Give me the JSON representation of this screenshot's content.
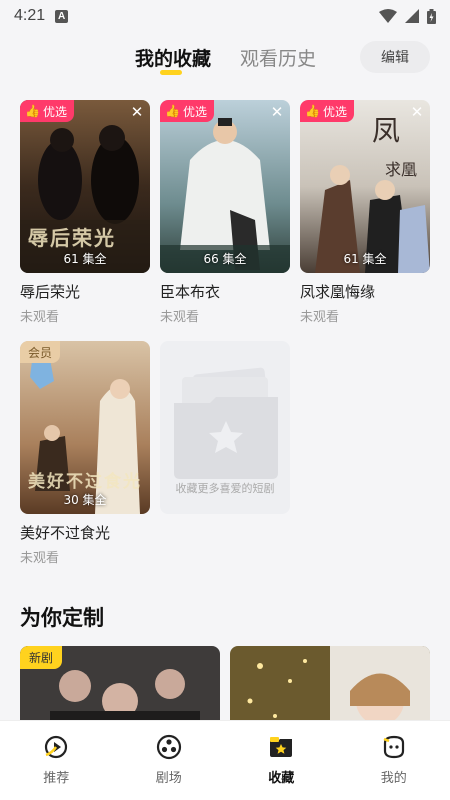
{
  "status": {
    "time": "4:21",
    "a_label": "A"
  },
  "tabs": {
    "favorites": "我的收藏",
    "history": "观看历史",
    "edit": "编辑"
  },
  "favorites": [
    {
      "badge": "优选",
      "title": "辱后荣光",
      "episodes": "61 集全",
      "status": "未观看",
      "overlay": "辱后荣光"
    },
    {
      "badge": "优选",
      "title": "臣本布衣",
      "episodes": "66 集全",
      "status": "未观看",
      "overlay": ""
    },
    {
      "badge": "优选",
      "title": "凤求凰悔缘",
      "episodes": "61 集全",
      "status": "未观看",
      "overlay": ""
    },
    {
      "badge": "会员",
      "title": "美好不过食光",
      "episodes": "30 集全",
      "status": "未观看",
      "overlay": "美好不过食光"
    }
  ],
  "empty_card": {
    "text": "收藏更多喜爱的短剧"
  },
  "section": {
    "title": "为你定制",
    "new_badge": "新剧"
  },
  "nav": [
    {
      "label": "推荐",
      "icon": "recommend-icon"
    },
    {
      "label": "剧场",
      "icon": "theater-icon"
    },
    {
      "label": "收藏",
      "icon": "favorites-icon"
    },
    {
      "label": "我的",
      "icon": "profile-icon"
    }
  ],
  "colors": {
    "accent": "#ffd21e",
    "badge_pink": "#ff3a6a",
    "member": "#e9cda6"
  }
}
